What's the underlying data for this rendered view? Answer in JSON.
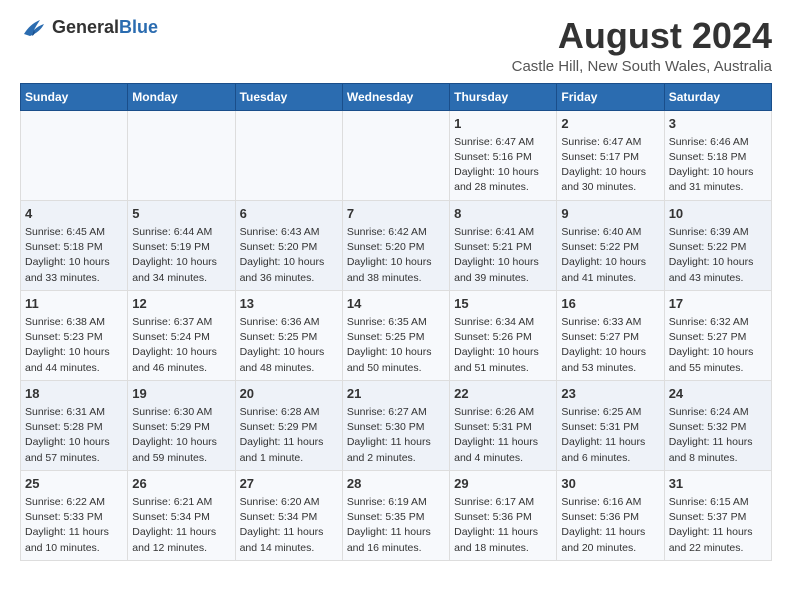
{
  "header": {
    "logo_general": "General",
    "logo_blue": "Blue",
    "title": "August 2024",
    "subtitle": "Castle Hill, New South Wales, Australia"
  },
  "calendar": {
    "days_of_week": [
      "Sunday",
      "Monday",
      "Tuesday",
      "Wednesday",
      "Thursday",
      "Friday",
      "Saturday"
    ],
    "weeks": [
      [
        {
          "day": "",
          "info": ""
        },
        {
          "day": "",
          "info": ""
        },
        {
          "day": "",
          "info": ""
        },
        {
          "day": "",
          "info": ""
        },
        {
          "day": "1",
          "info": "Sunrise: 6:47 AM\nSunset: 5:16 PM\nDaylight: 10 hours\nand 28 minutes."
        },
        {
          "day": "2",
          "info": "Sunrise: 6:47 AM\nSunset: 5:17 PM\nDaylight: 10 hours\nand 30 minutes."
        },
        {
          "day": "3",
          "info": "Sunrise: 6:46 AM\nSunset: 5:18 PM\nDaylight: 10 hours\nand 31 minutes."
        }
      ],
      [
        {
          "day": "4",
          "info": "Sunrise: 6:45 AM\nSunset: 5:18 PM\nDaylight: 10 hours\nand 33 minutes."
        },
        {
          "day": "5",
          "info": "Sunrise: 6:44 AM\nSunset: 5:19 PM\nDaylight: 10 hours\nand 34 minutes."
        },
        {
          "day": "6",
          "info": "Sunrise: 6:43 AM\nSunset: 5:20 PM\nDaylight: 10 hours\nand 36 minutes."
        },
        {
          "day": "7",
          "info": "Sunrise: 6:42 AM\nSunset: 5:20 PM\nDaylight: 10 hours\nand 38 minutes."
        },
        {
          "day": "8",
          "info": "Sunrise: 6:41 AM\nSunset: 5:21 PM\nDaylight: 10 hours\nand 39 minutes."
        },
        {
          "day": "9",
          "info": "Sunrise: 6:40 AM\nSunset: 5:22 PM\nDaylight: 10 hours\nand 41 minutes."
        },
        {
          "day": "10",
          "info": "Sunrise: 6:39 AM\nSunset: 5:22 PM\nDaylight: 10 hours\nand 43 minutes."
        }
      ],
      [
        {
          "day": "11",
          "info": "Sunrise: 6:38 AM\nSunset: 5:23 PM\nDaylight: 10 hours\nand 44 minutes."
        },
        {
          "day": "12",
          "info": "Sunrise: 6:37 AM\nSunset: 5:24 PM\nDaylight: 10 hours\nand 46 minutes."
        },
        {
          "day": "13",
          "info": "Sunrise: 6:36 AM\nSunset: 5:25 PM\nDaylight: 10 hours\nand 48 minutes."
        },
        {
          "day": "14",
          "info": "Sunrise: 6:35 AM\nSunset: 5:25 PM\nDaylight: 10 hours\nand 50 minutes."
        },
        {
          "day": "15",
          "info": "Sunrise: 6:34 AM\nSunset: 5:26 PM\nDaylight: 10 hours\nand 51 minutes."
        },
        {
          "day": "16",
          "info": "Sunrise: 6:33 AM\nSunset: 5:27 PM\nDaylight: 10 hours\nand 53 minutes."
        },
        {
          "day": "17",
          "info": "Sunrise: 6:32 AM\nSunset: 5:27 PM\nDaylight: 10 hours\nand 55 minutes."
        }
      ],
      [
        {
          "day": "18",
          "info": "Sunrise: 6:31 AM\nSunset: 5:28 PM\nDaylight: 10 hours\nand 57 minutes."
        },
        {
          "day": "19",
          "info": "Sunrise: 6:30 AM\nSunset: 5:29 PM\nDaylight: 10 hours\nand 59 minutes."
        },
        {
          "day": "20",
          "info": "Sunrise: 6:28 AM\nSunset: 5:29 PM\nDaylight: 11 hours\nand 1 minute."
        },
        {
          "day": "21",
          "info": "Sunrise: 6:27 AM\nSunset: 5:30 PM\nDaylight: 11 hours\nand 2 minutes."
        },
        {
          "day": "22",
          "info": "Sunrise: 6:26 AM\nSunset: 5:31 PM\nDaylight: 11 hours\nand 4 minutes."
        },
        {
          "day": "23",
          "info": "Sunrise: 6:25 AM\nSunset: 5:31 PM\nDaylight: 11 hours\nand 6 minutes."
        },
        {
          "day": "24",
          "info": "Sunrise: 6:24 AM\nSunset: 5:32 PM\nDaylight: 11 hours\nand 8 minutes."
        }
      ],
      [
        {
          "day": "25",
          "info": "Sunrise: 6:22 AM\nSunset: 5:33 PM\nDaylight: 11 hours\nand 10 minutes."
        },
        {
          "day": "26",
          "info": "Sunrise: 6:21 AM\nSunset: 5:34 PM\nDaylight: 11 hours\nand 12 minutes."
        },
        {
          "day": "27",
          "info": "Sunrise: 6:20 AM\nSunset: 5:34 PM\nDaylight: 11 hours\nand 14 minutes."
        },
        {
          "day": "28",
          "info": "Sunrise: 6:19 AM\nSunset: 5:35 PM\nDaylight: 11 hours\nand 16 minutes."
        },
        {
          "day": "29",
          "info": "Sunrise: 6:17 AM\nSunset: 5:36 PM\nDaylight: 11 hours\nand 18 minutes."
        },
        {
          "day": "30",
          "info": "Sunrise: 6:16 AM\nSunset: 5:36 PM\nDaylight: 11 hours\nand 20 minutes."
        },
        {
          "day": "31",
          "info": "Sunrise: 6:15 AM\nSunset: 5:37 PM\nDaylight: 11 hours\nand 22 minutes."
        }
      ]
    ]
  }
}
